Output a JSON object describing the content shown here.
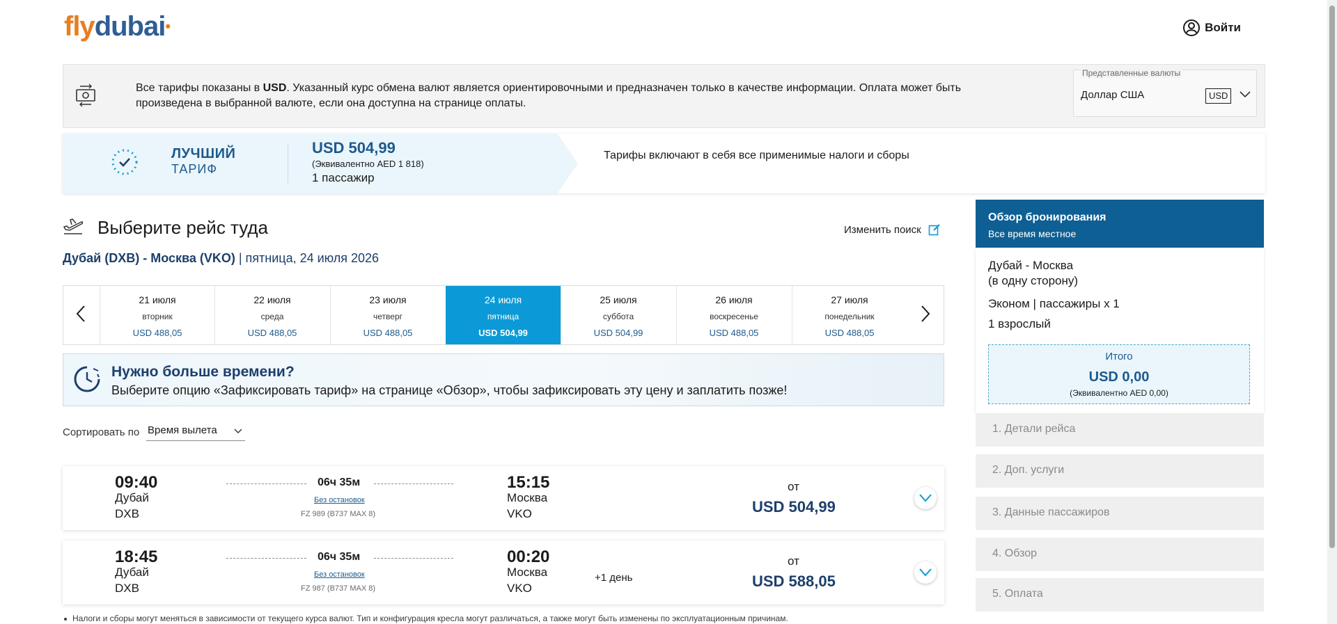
{
  "header": {
    "logo_fly": "fly",
    "logo_dubai": "dubai",
    "login_label": "Войти"
  },
  "currency_notice": {
    "text_prefix": "Все тарифы показаны в ",
    "text_currency": "USD",
    "text_suffix": ". Указанный курс обмена валют является ориентировочными и предназначен только в качестве информации. Оплата может быть произведена в выбранной валюте, если она доступна на странице оплаты.",
    "select_label": "Представленные валюты",
    "select_value": "Доллар США",
    "select_code": "USD"
  },
  "best_fare": {
    "label_line1": "ЛУЧШИЙ",
    "label_line2": "ТАРИФ",
    "price": "USD 504,99",
    "equivalent": "(Эквивалентно AED 1 818)",
    "passengers": "1 пассажир",
    "note": "Тарифы включают в себя все применимые налоги и сборы"
  },
  "outbound": {
    "title": "Выберите рейс туда",
    "modify_search": "Изменить поиск",
    "route": "Дубай (DXB) - Москва (VKO)",
    "date_text": " | пятница, 24 июля 2026"
  },
  "dates": [
    {
      "date": "21 июля",
      "day": "вторник",
      "price": "USD 488,05",
      "active": false
    },
    {
      "date": "22 июля",
      "day": "среда",
      "price": "USD 488,05",
      "active": false
    },
    {
      "date": "23 июля",
      "day": "четверг",
      "price": "USD 488,05",
      "active": false
    },
    {
      "date": "24 июля",
      "day": "пятница",
      "price": "USD 504,99",
      "active": true
    },
    {
      "date": "25 июля",
      "day": "суббота",
      "price": "USD 504,99",
      "active": false
    },
    {
      "date": "26 июля",
      "day": "воскресенье",
      "price": "USD 488,05",
      "active": false
    },
    {
      "date": "27 июля",
      "day": "понедельник",
      "price": "USD 488,05",
      "active": false
    }
  ],
  "hold": {
    "title": "Нужно больше времени?",
    "text": "Выберите опцию «Зафиксировать тариф» на странице «Обзор», чтобы зафиксировать эту цену и заплатить позже!"
  },
  "sort": {
    "label": "Сортировать по",
    "value": "Время вылета"
  },
  "flights": [
    {
      "dep_time": "09:40",
      "dep_city": "Дубай",
      "dep_code": "DXB",
      "duration": "06ч 35м",
      "stops": "Без остановок",
      "flight_no": "FZ 989 (B737 MAX 8)",
      "arr_time": "15:15",
      "arr_city": "Москва",
      "arr_code": "VKO",
      "next_day": "",
      "from_label": "от",
      "price": "USD 504,99"
    },
    {
      "dep_time": "18:45",
      "dep_city": "Дубай",
      "dep_code": "DXB",
      "duration": "06ч 35м",
      "stops": "Без остановок",
      "flight_no": "FZ 987 (B737 MAX 8)",
      "arr_time": "00:20",
      "arr_city": "Москва",
      "arr_code": "VKO",
      "next_day": "+1 день",
      "from_label": "от",
      "price": "USD 588,05"
    }
  ],
  "footnote": "Налоги и сборы могут меняться в зависимости от текущего курса валют. Тип и конфигурация кресла могут различаться, а также могут быть изменены по эксплуатационным причинам.",
  "sidebar": {
    "title": "Обзор бронирования",
    "subtitle": "Все время местное",
    "route": "Дубай - Москва",
    "trip_type": "(в одну сторону)",
    "class_pax": "Эконом | пассажиры x 1",
    "adults": "1 взрослый",
    "total_label": "Итого",
    "total_amount": "USD 0,00",
    "total_equiv": "(Эквивалентно AED 0,00)",
    "steps": [
      "1. Детали рейса",
      "2. Доп. услуги",
      "3. Данные пассажиров",
      "4. Обзор",
      "5. Оплата"
    ]
  },
  "colors": {
    "brand_orange": "#e97d22",
    "brand_blue": "#2f5d95",
    "accent_blue": "#0b9ad7",
    "header_blue": "#0e5f93",
    "price_blue": "#1d5a8e"
  }
}
